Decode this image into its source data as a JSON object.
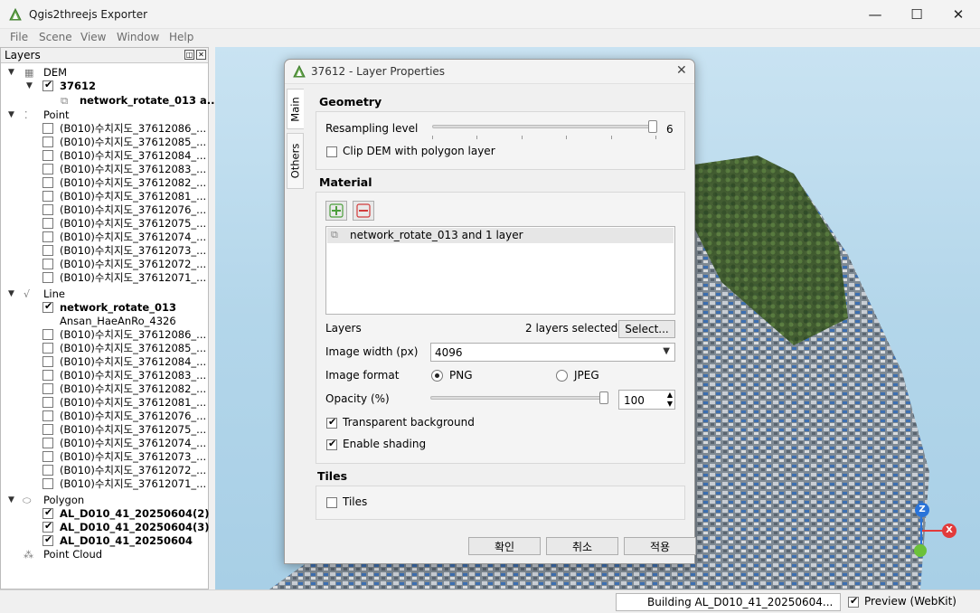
{
  "window": {
    "title": "Qgis2threejs Exporter",
    "minimize": "—",
    "maximize": "☐",
    "close": "✕"
  },
  "menu": [
    "File",
    "Scene",
    "View",
    "Window",
    "Help"
  ],
  "layers_panel": {
    "title": "Layers",
    "groups": {
      "dem": {
        "label": "DEM",
        "child": "37612",
        "subchild": "network_rotate_013 a..."
      },
      "point": {
        "label": "Point",
        "items": [
          "(B010)수치지도_37612086_...",
          "(B010)수치지도_37612085_...",
          "(B010)수치지도_37612084_...",
          "(B010)수치지도_37612083_...",
          "(B010)수치지도_37612082_...",
          "(B010)수치지도_37612081_...",
          "(B010)수치지도_37612076_...",
          "(B010)수치지도_37612075_...",
          "(B010)수치지도_37612074_...",
          "(B010)수치지도_37612073_...",
          "(B010)수치지도_37612072_...",
          "(B010)수치지도_37612071_..."
        ]
      },
      "line": {
        "label": "Line",
        "checked_item": "network_rotate_013",
        "item2": "Ansan_HaeAnRo_4326",
        "items": [
          "(B010)수치지도_37612086_...",
          "(B010)수치지도_37612085_...",
          "(B010)수치지도_37612084_...",
          "(B010)수치지도_37612083_...",
          "(B010)수치지도_37612082_...",
          "(B010)수치지도_37612081_...",
          "(B010)수치지도_37612076_...",
          "(B010)수치지도_37612075_...",
          "(B010)수치지도_37612074_...",
          "(B010)수치지도_37612073_...",
          "(B010)수치지도_37612072_...",
          "(B010)수치지도_37612071_..."
        ]
      },
      "polygon": {
        "label": "Polygon",
        "items": [
          "AL_D010_41_20250604(2)",
          "AL_D010_41_20250604(3)",
          "AL_D010_41_20250604"
        ]
      },
      "pointcloud": {
        "label": "Point Cloud"
      }
    }
  },
  "dialog": {
    "title": "37612 - Layer Properties",
    "tabs": [
      "Main",
      "Others"
    ],
    "geometry": {
      "heading": "Geometry",
      "resampling_label": "Resampling level",
      "resampling_value": "6",
      "resampling_fraction": 1.0,
      "clip_label": "Clip DEM with polygon layer"
    },
    "material": {
      "heading": "Material",
      "list_item": "network_rotate_013 and 1 layer",
      "layers_label": "Layers",
      "layers_selected": "2 layers selected",
      "select_button": "Select...",
      "image_width_label": "Image width (px)",
      "image_width_value": "4096",
      "image_format_label": "Image format",
      "format_png": "PNG",
      "format_jpeg": "JPEG",
      "opacity_label": "Opacity (%)",
      "opacity_value": "100",
      "opacity_fraction": 1.0,
      "transparent_label": "Transparent background",
      "shading_label": "Enable shading"
    },
    "tiles": {
      "heading": "Tiles",
      "tiles_label": "Tiles"
    },
    "buttons": {
      "ok": "확인",
      "cancel": "취소",
      "apply": "적용"
    }
  },
  "status": {
    "building": "Building AL_D010_41_20250604...",
    "preview_label": "Preview (WebKit)"
  },
  "axes": {
    "z": "Z",
    "x": "X"
  },
  "colors": {
    "accent_green": "#4b9e3a",
    "axis_z": "#2a74d9",
    "axis_x": "#e23b3b",
    "axis_y": "#6bc13a"
  }
}
